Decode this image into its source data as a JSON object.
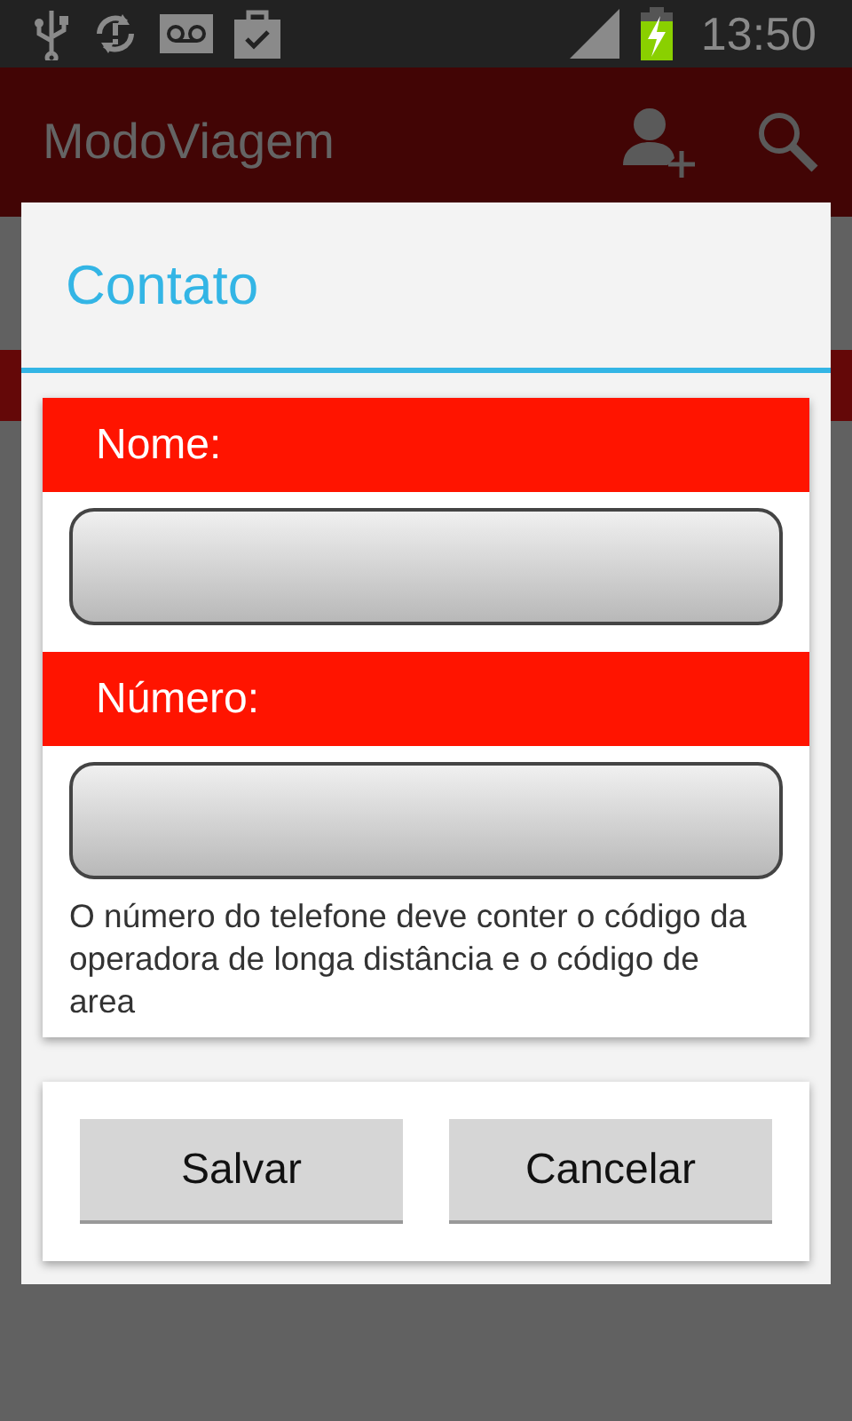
{
  "status_bar": {
    "time": "13:50"
  },
  "app_bar": {
    "title": "ModoViagem"
  },
  "dialog": {
    "title": "Contato",
    "fields": [
      {
        "label": "Nome:"
      },
      {
        "label": "Número:"
      }
    ],
    "hint": "O número do telefone deve conter o código da operadora de longa distância e o código de area",
    "buttons": [
      "Salvar",
      "Cancelar"
    ]
  }
}
